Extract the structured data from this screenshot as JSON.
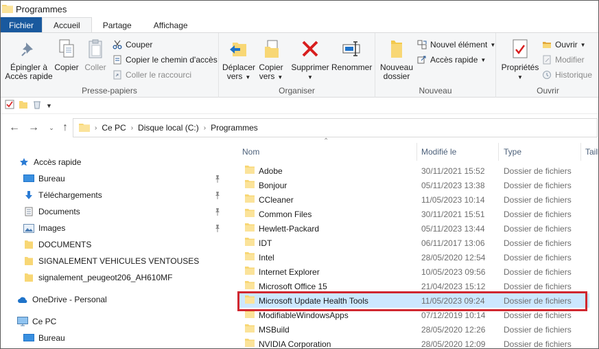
{
  "window": {
    "title": "Programmes"
  },
  "tabs": [
    {
      "label": "Fichier"
    },
    {
      "label": "Accueil"
    },
    {
      "label": "Partage"
    },
    {
      "label": "Affichage"
    }
  ],
  "ribbon": {
    "clipboard": {
      "group_label": "Presse-papiers",
      "pin_label_1": "Épingler à",
      "pin_label_2": "Accès rapide",
      "copy_label": "Copier",
      "paste_label": "Coller",
      "cut_label": "Couper",
      "copy_path_label": "Copier le chemin d'accès",
      "paste_shortcut_label": "Coller le raccourci"
    },
    "organize": {
      "group_label": "Organiser",
      "move_label_1": "Déplacer",
      "move_label_2": "vers",
      "copyto_label_1": "Copier",
      "copyto_label_2": "vers",
      "delete_label": "Supprimer",
      "rename_label": "Renommer"
    },
    "new": {
      "group_label": "Nouveau",
      "new_folder_label_1": "Nouveau",
      "new_folder_label_2": "dossier",
      "new_item_label": "Nouvel élément",
      "easy_access_label": "Accès rapide"
    },
    "open": {
      "group_label": "Ouvrir",
      "properties_label": "Propriétés",
      "open_label": "Ouvrir",
      "edit_label": "Modifier",
      "history_label": "Historique"
    }
  },
  "address": {
    "crumbs": [
      "Ce PC",
      "Disque local (C:)",
      "Programmes"
    ]
  },
  "sidebar": {
    "quick_access": "Accès rapide",
    "items": [
      {
        "label": "Bureau"
      },
      {
        "label": "Téléchargements"
      },
      {
        "label": "Documents"
      },
      {
        "label": "Images"
      },
      {
        "label": "DOCUMENTS"
      },
      {
        "label": "SIGNALEMENT VEHICULES VENTOUSES"
      },
      {
        "label": "signalement_peugeot206_AH610MF"
      }
    ],
    "onedrive": "OneDrive - Personal",
    "this_pc": "Ce PC",
    "this_pc_desktop": "Bureau"
  },
  "columns": {
    "name": "Nom",
    "modified": "Modifié le",
    "type": "Type",
    "size": "Taill"
  },
  "files": [
    {
      "name": "Adobe",
      "date": "30/11/2021 15:52",
      "type": "Dossier de fichiers"
    },
    {
      "name": "Bonjour",
      "date": "05/11/2023 13:38",
      "type": "Dossier de fichiers"
    },
    {
      "name": "CCleaner",
      "date": "11/05/2023 10:14",
      "type": "Dossier de fichiers"
    },
    {
      "name": "Common Files",
      "date": "30/11/2021 15:51",
      "type": "Dossier de fichiers"
    },
    {
      "name": "Hewlett-Packard",
      "date": "05/11/2023 13:44",
      "type": "Dossier de fichiers"
    },
    {
      "name": "IDT",
      "date": "06/11/2017 13:06",
      "type": "Dossier de fichiers"
    },
    {
      "name": "Intel",
      "date": "28/05/2020 12:54",
      "type": "Dossier de fichiers"
    },
    {
      "name": "Internet Explorer",
      "date": "10/05/2023 09:56",
      "type": "Dossier de fichiers"
    },
    {
      "name": "Microsoft Office 15",
      "date": "21/04/2023 15:12",
      "type": "Dossier de fichiers"
    },
    {
      "name": "Microsoft Update Health Tools",
      "date": "11/05/2023 09:24",
      "type": "Dossier de fichiers"
    },
    {
      "name": "ModifiableWindowsApps",
      "date": "07/12/2019 10:14",
      "type": "Dossier de fichiers"
    },
    {
      "name": "MSBuild",
      "date": "28/05/2020 12:26",
      "type": "Dossier de fichiers"
    },
    {
      "name": "NVIDIA Corporation",
      "date": "28/05/2020 12:09",
      "type": "Dossier de fichiers"
    }
  ],
  "selected_index": 9,
  "colors": {
    "file_tab": "#19599e",
    "folder": "#f8d775",
    "selection": "#cce8ff",
    "highlight_border": "#d0272f",
    "delete_red": "#d81e1e"
  }
}
